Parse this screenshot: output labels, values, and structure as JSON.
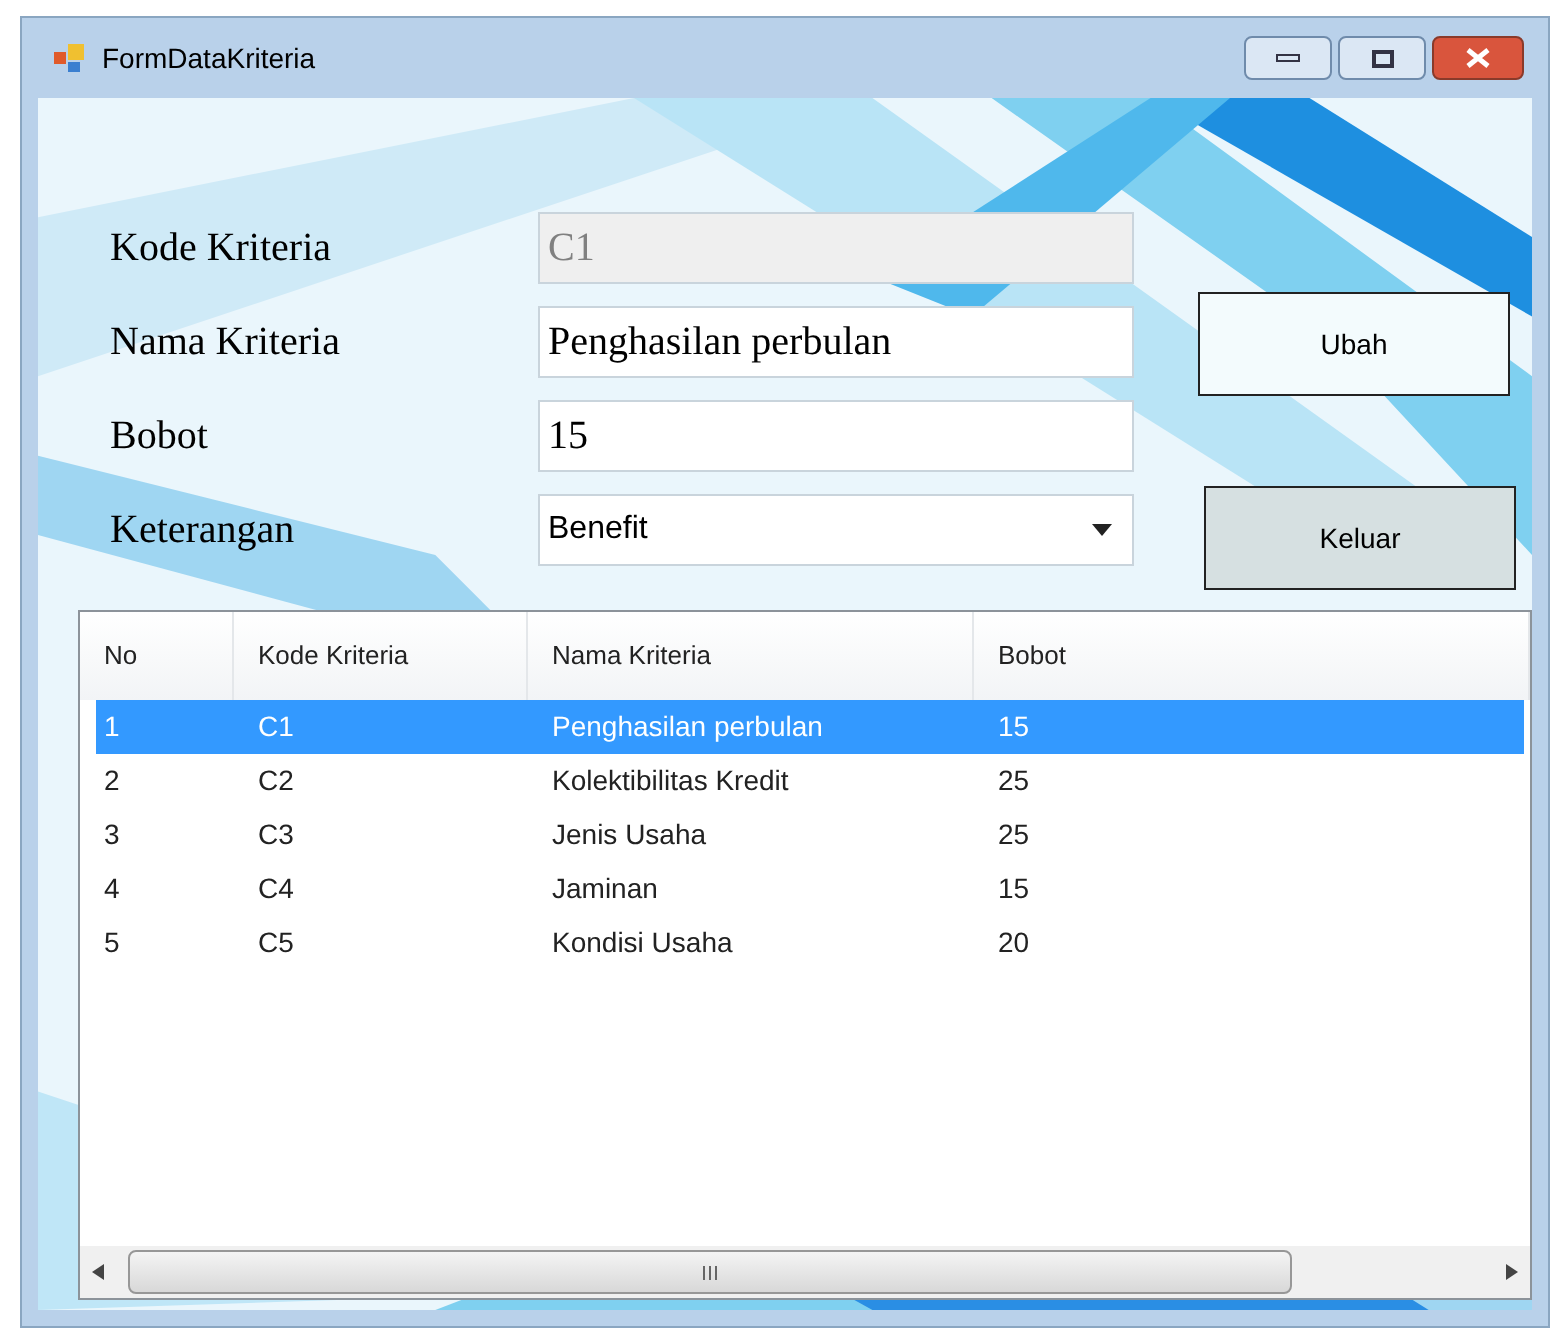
{
  "window": {
    "title": "FormDataKriteria"
  },
  "fields": [
    {
      "label": "Kode Kriteria",
      "kind": "text",
      "value": "C1",
      "disabled": true
    },
    {
      "label": "Nama Kriteria",
      "kind": "text",
      "value": "Penghasilan perbulan",
      "disabled": false
    },
    {
      "label": "Bobot",
      "kind": "text",
      "value": "15",
      "disabled": false
    },
    {
      "label": "Keterangan",
      "kind": "dropdown",
      "value": "Benefit",
      "disabled": false
    }
  ],
  "buttons": [
    {
      "label": "Ubah",
      "hovered": false
    },
    {
      "label": "Keluar",
      "hovered": true
    }
  ],
  "table": {
    "columns": [
      "No",
      "Kode Kriteria",
      "Nama Kriteria",
      "Bobot"
    ],
    "rows": [
      {
        "cells": [
          "1",
          "C1",
          "Penghasilan perbulan",
          "15"
        ],
        "selected": true
      },
      {
        "cells": [
          "2",
          "C2",
          "Kolektibilitas Kredit",
          "25"
        ],
        "selected": false
      },
      {
        "cells": [
          "3",
          "C3",
          "Jenis Usaha",
          "25"
        ],
        "selected": false
      },
      {
        "cells": [
          "4",
          "C4",
          "Jaminan",
          "15"
        ],
        "selected": false
      },
      {
        "cells": [
          "5",
          "C5",
          "Kondisi Usaha",
          "20"
        ],
        "selected": false
      }
    ]
  }
}
